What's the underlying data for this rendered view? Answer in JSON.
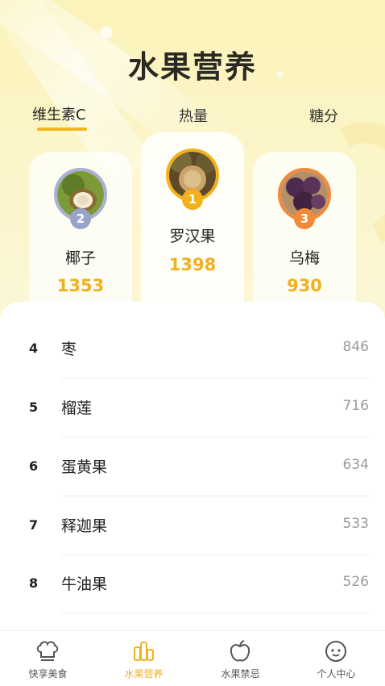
{
  "page": {
    "title": "水果营养"
  },
  "tabs": [
    {
      "label": "维生素C",
      "active": true
    },
    {
      "label": "热量",
      "active": false
    },
    {
      "label": "糖分",
      "active": false
    }
  ],
  "podium": [
    {
      "rank": "2",
      "name": "椰子",
      "value": "1353",
      "badge_color": "#9aa3c7"
    },
    {
      "rank": "1",
      "name": "罗汉果",
      "value": "1398",
      "badge_color": "#f2b11b"
    },
    {
      "rank": "3",
      "name": "乌梅",
      "value": "930",
      "badge_color": "#f08a3a"
    }
  ],
  "list": [
    {
      "rank": "4",
      "name": "枣",
      "value": "846"
    },
    {
      "rank": "5",
      "name": "榴莲",
      "value": "716"
    },
    {
      "rank": "6",
      "name": "蛋黄果",
      "value": "634"
    },
    {
      "rank": "7",
      "name": "释迦果",
      "value": "533"
    },
    {
      "rank": "8",
      "name": "牛油果",
      "value": "526"
    }
  ],
  "nav": [
    {
      "label": "快享美食",
      "icon": "chef-hat-icon",
      "active": false
    },
    {
      "label": "水果营养",
      "icon": "bar-chart-icon",
      "active": true
    },
    {
      "label": "水果禁忌",
      "icon": "apple-icon",
      "active": false
    },
    {
      "label": "个人中心",
      "icon": "face-icon",
      "active": false
    }
  ],
  "colors": {
    "accent": "#f0b020",
    "background": "#fbf6d6"
  }
}
